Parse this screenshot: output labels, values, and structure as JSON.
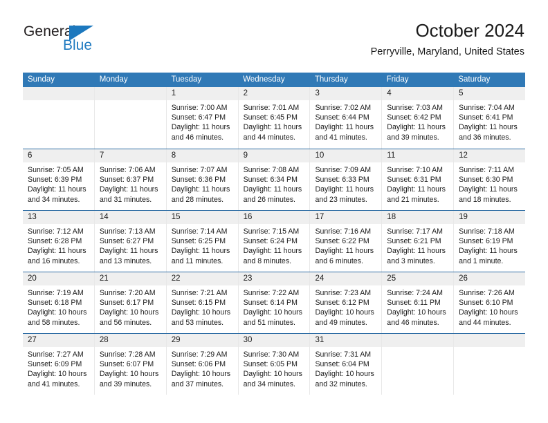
{
  "logo": {
    "part1": "General",
    "part2": "Blue",
    "accent_color": "#1c78be",
    "triangle_icon": "logo-triangle-icon"
  },
  "header": {
    "title": "October 2024",
    "subtitle": "Perryville, Maryland, United States"
  },
  "calendar": {
    "header_bg": "#3079b6",
    "header_text_color": "#ffffff",
    "daynum_bg": "#efefef",
    "weekday_headers": [
      "Sunday",
      "Monday",
      "Tuesday",
      "Wednesday",
      "Thursday",
      "Friday",
      "Saturday"
    ],
    "labels": {
      "sunrise": "Sunrise:",
      "sunset": "Sunset:",
      "daylight": "Daylight:"
    },
    "weeks": [
      [
        {
          "day": ""
        },
        {
          "day": ""
        },
        {
          "day": "1",
          "sunrise": "Sunrise: 7:00 AM",
          "sunset": "Sunset: 6:47 PM",
          "daylight1": "Daylight: 11 hours",
          "daylight2": "and 46 minutes."
        },
        {
          "day": "2",
          "sunrise": "Sunrise: 7:01 AM",
          "sunset": "Sunset: 6:45 PM",
          "daylight1": "Daylight: 11 hours",
          "daylight2": "and 44 minutes."
        },
        {
          "day": "3",
          "sunrise": "Sunrise: 7:02 AM",
          "sunset": "Sunset: 6:44 PM",
          "daylight1": "Daylight: 11 hours",
          "daylight2": "and 41 minutes."
        },
        {
          "day": "4",
          "sunrise": "Sunrise: 7:03 AM",
          "sunset": "Sunset: 6:42 PM",
          "daylight1": "Daylight: 11 hours",
          "daylight2": "and 39 minutes."
        },
        {
          "day": "5",
          "sunrise": "Sunrise: 7:04 AM",
          "sunset": "Sunset: 6:41 PM",
          "daylight1": "Daylight: 11 hours",
          "daylight2": "and 36 minutes."
        }
      ],
      [
        {
          "day": "6",
          "sunrise": "Sunrise: 7:05 AM",
          "sunset": "Sunset: 6:39 PM",
          "daylight1": "Daylight: 11 hours",
          "daylight2": "and 34 minutes."
        },
        {
          "day": "7",
          "sunrise": "Sunrise: 7:06 AM",
          "sunset": "Sunset: 6:37 PM",
          "daylight1": "Daylight: 11 hours",
          "daylight2": "and 31 minutes."
        },
        {
          "day": "8",
          "sunrise": "Sunrise: 7:07 AM",
          "sunset": "Sunset: 6:36 PM",
          "daylight1": "Daylight: 11 hours",
          "daylight2": "and 28 minutes."
        },
        {
          "day": "9",
          "sunrise": "Sunrise: 7:08 AM",
          "sunset": "Sunset: 6:34 PM",
          "daylight1": "Daylight: 11 hours",
          "daylight2": "and 26 minutes."
        },
        {
          "day": "10",
          "sunrise": "Sunrise: 7:09 AM",
          "sunset": "Sunset: 6:33 PM",
          "daylight1": "Daylight: 11 hours",
          "daylight2": "and 23 minutes."
        },
        {
          "day": "11",
          "sunrise": "Sunrise: 7:10 AM",
          "sunset": "Sunset: 6:31 PM",
          "daylight1": "Daylight: 11 hours",
          "daylight2": "and 21 minutes."
        },
        {
          "day": "12",
          "sunrise": "Sunrise: 7:11 AM",
          "sunset": "Sunset: 6:30 PM",
          "daylight1": "Daylight: 11 hours",
          "daylight2": "and 18 minutes."
        }
      ],
      [
        {
          "day": "13",
          "sunrise": "Sunrise: 7:12 AM",
          "sunset": "Sunset: 6:28 PM",
          "daylight1": "Daylight: 11 hours",
          "daylight2": "and 16 minutes."
        },
        {
          "day": "14",
          "sunrise": "Sunrise: 7:13 AM",
          "sunset": "Sunset: 6:27 PM",
          "daylight1": "Daylight: 11 hours",
          "daylight2": "and 13 minutes."
        },
        {
          "day": "15",
          "sunrise": "Sunrise: 7:14 AM",
          "sunset": "Sunset: 6:25 PM",
          "daylight1": "Daylight: 11 hours",
          "daylight2": "and 11 minutes."
        },
        {
          "day": "16",
          "sunrise": "Sunrise: 7:15 AM",
          "sunset": "Sunset: 6:24 PM",
          "daylight1": "Daylight: 11 hours",
          "daylight2": "and 8 minutes."
        },
        {
          "day": "17",
          "sunrise": "Sunrise: 7:16 AM",
          "sunset": "Sunset: 6:22 PM",
          "daylight1": "Daylight: 11 hours",
          "daylight2": "and 6 minutes."
        },
        {
          "day": "18",
          "sunrise": "Sunrise: 7:17 AM",
          "sunset": "Sunset: 6:21 PM",
          "daylight1": "Daylight: 11 hours",
          "daylight2": "and 3 minutes."
        },
        {
          "day": "19",
          "sunrise": "Sunrise: 7:18 AM",
          "sunset": "Sunset: 6:19 PM",
          "daylight1": "Daylight: 11 hours",
          "daylight2": "and 1 minute."
        }
      ],
      [
        {
          "day": "20",
          "sunrise": "Sunrise: 7:19 AM",
          "sunset": "Sunset: 6:18 PM",
          "daylight1": "Daylight: 10 hours",
          "daylight2": "and 58 minutes."
        },
        {
          "day": "21",
          "sunrise": "Sunrise: 7:20 AM",
          "sunset": "Sunset: 6:17 PM",
          "daylight1": "Daylight: 10 hours",
          "daylight2": "and 56 minutes."
        },
        {
          "day": "22",
          "sunrise": "Sunrise: 7:21 AM",
          "sunset": "Sunset: 6:15 PM",
          "daylight1": "Daylight: 10 hours",
          "daylight2": "and 53 minutes."
        },
        {
          "day": "23",
          "sunrise": "Sunrise: 7:22 AM",
          "sunset": "Sunset: 6:14 PM",
          "daylight1": "Daylight: 10 hours",
          "daylight2": "and 51 minutes."
        },
        {
          "day": "24",
          "sunrise": "Sunrise: 7:23 AM",
          "sunset": "Sunset: 6:12 PM",
          "daylight1": "Daylight: 10 hours",
          "daylight2": "and 49 minutes."
        },
        {
          "day": "25",
          "sunrise": "Sunrise: 7:24 AM",
          "sunset": "Sunset: 6:11 PM",
          "daylight1": "Daylight: 10 hours",
          "daylight2": "and 46 minutes."
        },
        {
          "day": "26",
          "sunrise": "Sunrise: 7:26 AM",
          "sunset": "Sunset: 6:10 PM",
          "daylight1": "Daylight: 10 hours",
          "daylight2": "and 44 minutes."
        }
      ],
      [
        {
          "day": "27",
          "sunrise": "Sunrise: 7:27 AM",
          "sunset": "Sunset: 6:09 PM",
          "daylight1": "Daylight: 10 hours",
          "daylight2": "and 41 minutes."
        },
        {
          "day": "28",
          "sunrise": "Sunrise: 7:28 AM",
          "sunset": "Sunset: 6:07 PM",
          "daylight1": "Daylight: 10 hours",
          "daylight2": "and 39 minutes."
        },
        {
          "day": "29",
          "sunrise": "Sunrise: 7:29 AM",
          "sunset": "Sunset: 6:06 PM",
          "daylight1": "Daylight: 10 hours",
          "daylight2": "and 37 minutes."
        },
        {
          "day": "30",
          "sunrise": "Sunrise: 7:30 AM",
          "sunset": "Sunset: 6:05 PM",
          "daylight1": "Daylight: 10 hours",
          "daylight2": "and 34 minutes."
        },
        {
          "day": "31",
          "sunrise": "Sunrise: 7:31 AM",
          "sunset": "Sunset: 6:04 PM",
          "daylight1": "Daylight: 10 hours",
          "daylight2": "and 32 minutes."
        },
        {
          "day": ""
        },
        {
          "day": ""
        }
      ]
    ]
  }
}
